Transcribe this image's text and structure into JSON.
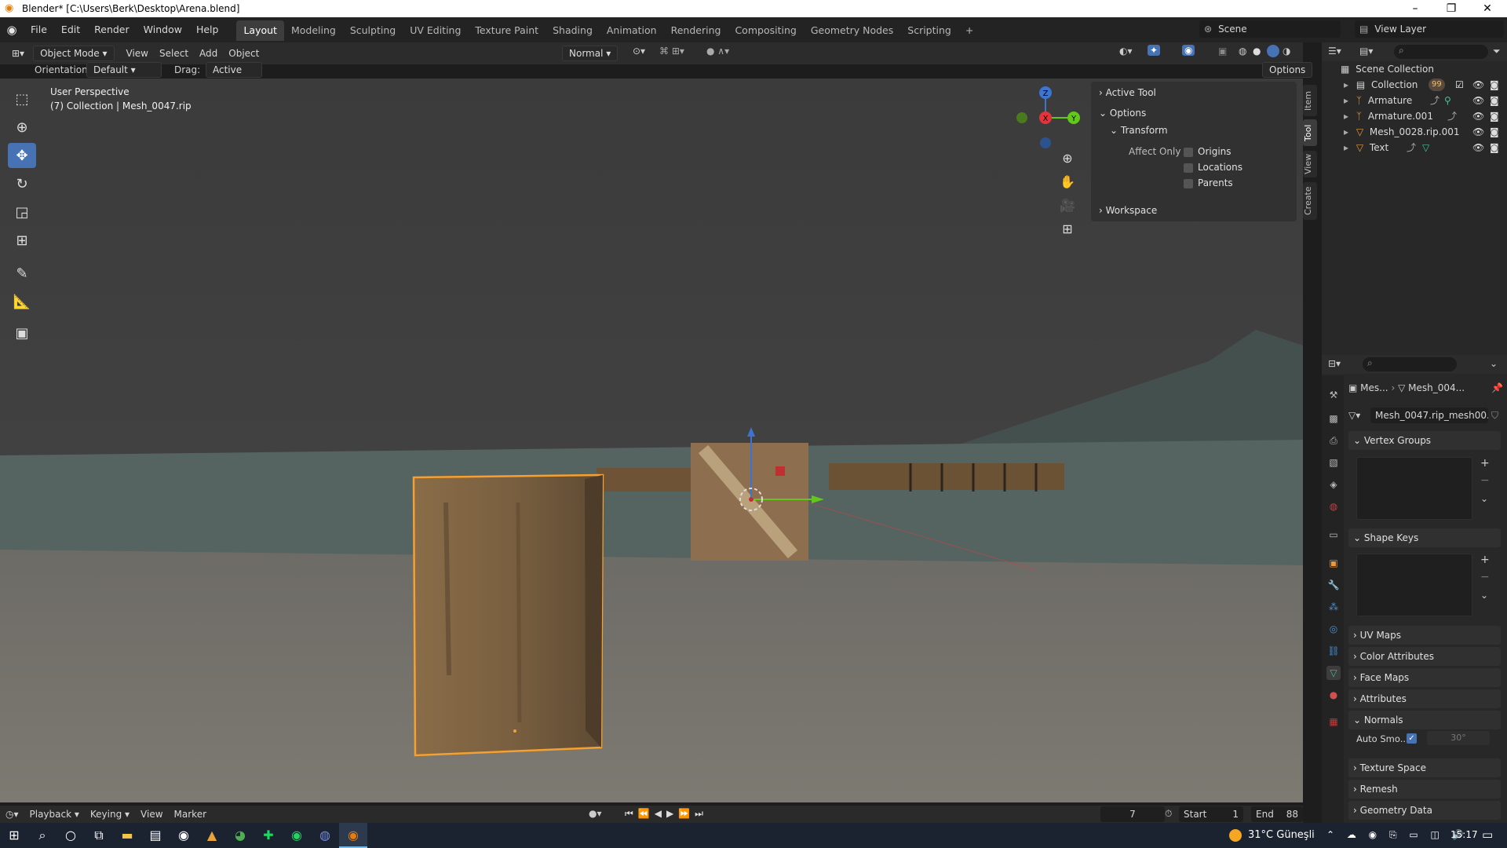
{
  "window": {
    "title": "Blender* [C:\\Users\\Berk\\Desktop\\Arena.blend]",
    "minimize": "–",
    "maximize": "❐",
    "close": "✕"
  },
  "menu": [
    "File",
    "Edit",
    "Render",
    "Window",
    "Help"
  ],
  "workspaces": [
    "Layout",
    "Modeling",
    "Sculpting",
    "UV Editing",
    "Texture Paint",
    "Shading",
    "Animation",
    "Rendering",
    "Compositing",
    "Geometry Nodes",
    "Scripting",
    "+"
  ],
  "scene": {
    "label": "Scene",
    "view_layer": "View Layer"
  },
  "header3d": {
    "mode": "Object Mode",
    "view": "View",
    "select": "Select",
    "add": "Add",
    "object": "Object",
    "orientation_mode": "Normal"
  },
  "toolhdr": {
    "orientation_label": "Orientation:",
    "orientation_value": "Default",
    "drag_label": "Drag:",
    "drag_value": "Active Tool",
    "options": "Options"
  },
  "viewport": {
    "perspective": "User Perspective",
    "collection_info": "(7) Collection | Mesh_0047.rip"
  },
  "npanel": {
    "active_tool": "Active Tool",
    "options": "Options",
    "transform": "Transform",
    "affect_only": "Affect Only",
    "origins": "Origins",
    "locations": "Locations",
    "parents": "Parents",
    "workspace": "Workspace"
  },
  "vtabs": [
    "Item",
    "Tool",
    "View",
    "Create"
  ],
  "outliner": {
    "root": "Scene Collection",
    "items": [
      {
        "name": "Collection",
        "icon": "collection-icon"
      },
      {
        "name": "Armature",
        "icon": "armature-icon"
      },
      {
        "name": "Armature.001",
        "icon": "armature-icon"
      },
      {
        "name": "Mesh_0028.rip.001",
        "icon": "mesh-icon"
      },
      {
        "name": "Text",
        "icon": "mesh-icon"
      }
    ],
    "badge": "99"
  },
  "props": {
    "breadcrumb_1": "Mes...",
    "breadcrumb_2": "Mesh_004...",
    "mesh_name": "Mesh_0047.rip_mesh00...",
    "sections": [
      "Vertex Groups",
      "Shape Keys",
      "UV Maps",
      "Color Attributes",
      "Face Maps",
      "Attributes",
      "Normals",
      "Texture Space",
      "Remesh",
      "Geometry Data"
    ],
    "auto_smooth_label": "Auto Smo...",
    "auto_smooth_angle": "30°"
  },
  "timeline": {
    "playback": "Playback",
    "keying": "Keying",
    "view": "View",
    "marker": "Marker",
    "current_frame": "7",
    "start_label": "Start",
    "start": "1",
    "end_label": "End",
    "end": "88"
  },
  "taskbar": {
    "weather": "31°C  Güneşli",
    "time": "15:17"
  },
  "gizmo": {
    "z": "Z",
    "y": "Y",
    "x": "X"
  },
  "colors": {
    "accent": "#4772b3",
    "selection": "#f5a030",
    "active_tab": "#3d3d3d"
  }
}
